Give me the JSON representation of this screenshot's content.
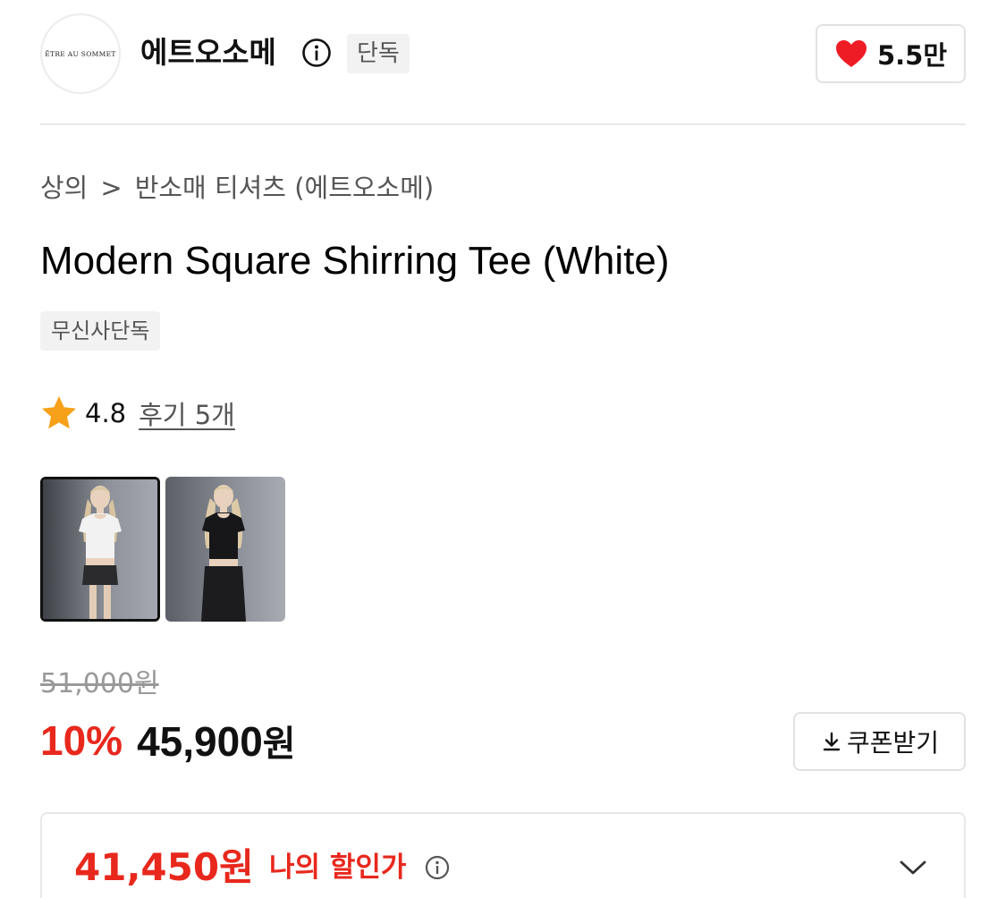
{
  "brand": {
    "logo_text": "ÊTRE AU SOMMET",
    "name": "에트오소메",
    "exclusive_badge": "단독",
    "like_count": "5.5만"
  },
  "breadcrumb": {
    "category": "상의",
    "separator": ">",
    "subcategory": "반소매 티셔츠 (에트오소메)"
  },
  "product": {
    "title": "Modern Square Shirring Tee (White)",
    "tag": "무신사단독",
    "rating": "4.8",
    "review_link": "후기 5개"
  },
  "thumbnails": [
    {
      "label": "white-tee",
      "selected": true
    },
    {
      "label": "black-tee",
      "selected": false
    }
  ],
  "price": {
    "original": "51,000원",
    "discount_rate": "10%",
    "sale_amount": "45,900",
    "sale_unit": "원",
    "coupon_label": "쿠폰받기"
  },
  "my_price": {
    "value": "41,450원",
    "label": "나의 할인가"
  },
  "colors": {
    "accent_red": "#e8281d",
    "heart_red": "#ee1c25",
    "star_orange": "#f7a01a"
  }
}
